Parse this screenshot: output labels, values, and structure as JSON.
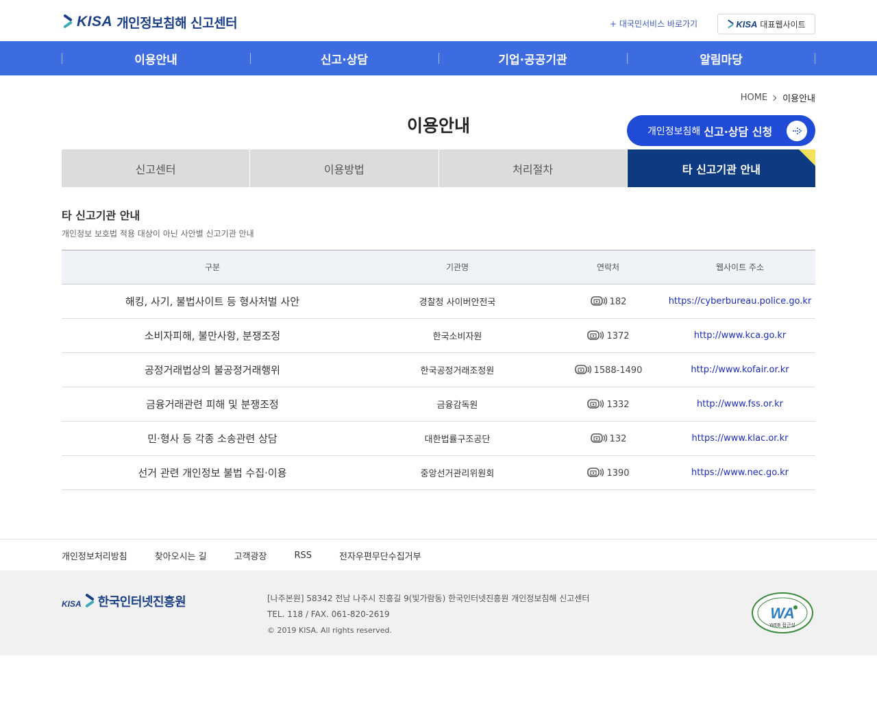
{
  "header": {
    "logo_kisa": "KISA",
    "logo_title": "개인정보침해 신고센터",
    "link_min": "+ 대국민서비스 바로가기",
    "kisa_site_logo": "KISA",
    "kisa_site_label": "대표웹사이트"
  },
  "gnb": {
    "items": [
      "이용안내",
      "신고·상담",
      "기업·공공기관",
      "알림마당"
    ]
  },
  "breadcrumb": {
    "home": "HOME",
    "current": "이용안내"
  },
  "page_title": "이용안내",
  "apply_button": {
    "label_light": "개인정보침해",
    "label_bold": "신고·상담 신청",
    "icon": "arrow-right-icon"
  },
  "tabs": [
    {
      "label": "신고센터",
      "active": false
    },
    {
      "label": "이용방법",
      "active": false
    },
    {
      "label": "처리절차",
      "active": false
    },
    {
      "label": "타 신고기관 안내",
      "active": true
    }
  ],
  "section": {
    "title": "타 신고기관 안내",
    "desc": "개인정보 보호법 적용 대상이 아닌 사안별 신고기관 안내"
  },
  "table": {
    "headers": [
      "구분",
      "기관명",
      "연락처",
      "웹사이트 주소"
    ],
    "rows": [
      {
        "category": "해킹, 사기, 불법사이트 등 형사처벌 사안",
        "org": "경찰청 사이버안전국",
        "tel": "182",
        "web": "https://cyberbureau.police.go.kr"
      },
      {
        "category": "소비자피해, 불만사항, 분쟁조정",
        "org": "한국소비자원",
        "tel": "1372",
        "web": "http://www.kca.go.kr"
      },
      {
        "category": "공정거래법상의 불공정거래행위",
        "org": "한국공정거래조정원",
        "tel": "1588-1490",
        "web": "http://www.kofair.or.kr"
      },
      {
        "category": "금융거래관련 피해 및 분쟁조정",
        "org": "금융감독원",
        "tel": "1332",
        "web": "http://www.fss.or.kr"
      },
      {
        "category": "민·형사 등 각종 소송관련 상담",
        "org": "대한법률구조공단",
        "tel": "132",
        "web": "https://www.klac.or.kr"
      },
      {
        "category": "선거 관련 개인정보 불법 수집·이용",
        "org": "중앙선거관리위원회",
        "tel": "1390",
        "web": "https://www.nec.go.kr"
      }
    ]
  },
  "footer_links": [
    "개인정보처리방침",
    "찾아오시는 길",
    "고객광장",
    "RSS",
    "전자우편무단수집거부"
  ],
  "footer": {
    "logo_kisa": "KISA",
    "logo_name": "한국인터넷진흥원",
    "address": "[나주본원] 58342 전남 나주시 진흥길 9(빛가람동) 한국인터넷진흥원 개인정보침해 신고센터",
    "tel_fax": "TEL. 118 / FAX. 061-820-2619",
    "copyright": "© 2019 KISA. All rights reserved.",
    "wa_mark_text": "WA",
    "wa_mark_sub": "WEB 접근성"
  },
  "colors": {
    "gnb_blue": "#3d6be0",
    "tab_active": "#0d3a80",
    "apply_button": "#1f4bd6",
    "link_blue": "#1b2bbf",
    "accent_yellow": "#f2e15a"
  }
}
